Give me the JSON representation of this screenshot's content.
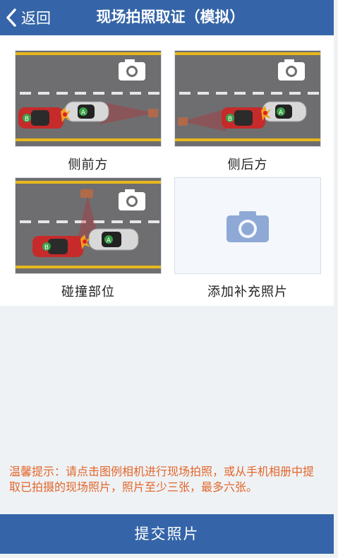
{
  "header": {
    "back_label": "返回",
    "title": "现场拍照取证（模拟）"
  },
  "cards": [
    {
      "label": "侧前方"
    },
    {
      "label": "侧后方"
    },
    {
      "label": "碰撞部位"
    },
    {
      "label": "添加补充照片"
    }
  ],
  "car_labels": {
    "a": "A",
    "b": "B"
  },
  "tip": "温馨提示：请点击图例相机进行现场拍照，或从手机相册中提取已拍摄的现场照片，照片至少三张，最多六张。",
  "submit_label": "提交照片",
  "colors": {
    "primary": "#3565a8",
    "tip": "#e2662a",
    "road": "#6e6e70",
    "line": "#e8b81c"
  }
}
